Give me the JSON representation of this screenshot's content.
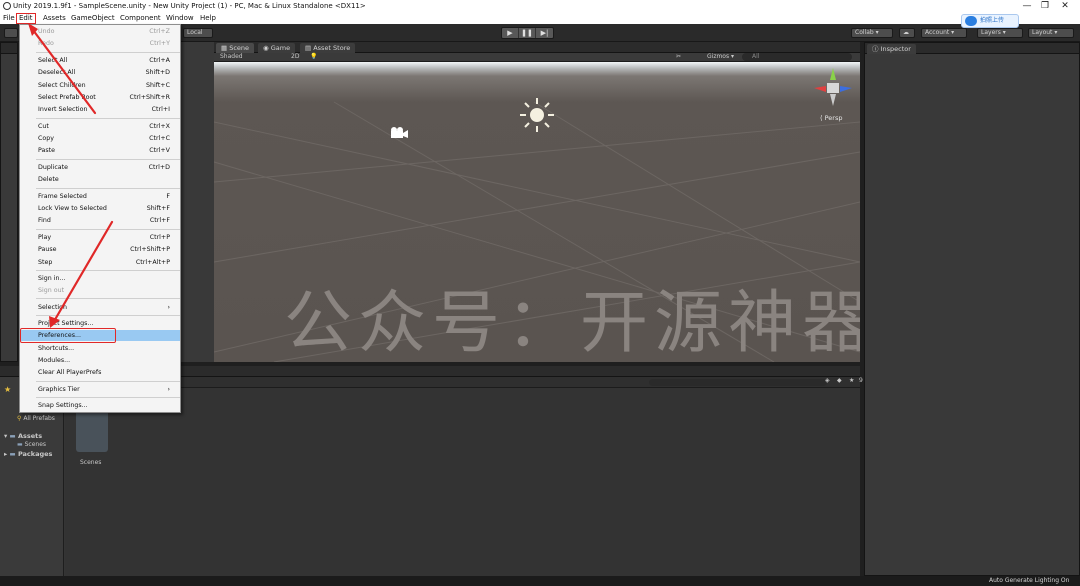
{
  "window": {
    "title": "Unity 2019.1.9f1 - SampleScene.unity - New Unity Project (1) - PC, Mac & Linux Standalone <DX11>",
    "controls": [
      "—",
      "❐",
      "✕"
    ]
  },
  "menubar": {
    "items": [
      "File",
      "Edit",
      "Assets",
      "GameObject",
      "Component",
      "Window",
      "Help"
    ]
  },
  "toolbar": {
    "local_label": "Local",
    "collab_label": "Collab",
    "account_label": "Account",
    "layers_label": "Layers",
    "layout_label": "Layout",
    "upload_badge": "拍照上传"
  },
  "edit_menu": {
    "groups": [
      [
        {
          "label": "Undo",
          "shortcut": "Ctrl+Z",
          "disabled": true
        },
        {
          "label": "Redo",
          "shortcut": "Ctrl+Y",
          "disabled": true
        }
      ],
      [
        {
          "label": "Select All",
          "shortcut": "Ctrl+A"
        },
        {
          "label": "Deselect All",
          "shortcut": "Shift+D"
        },
        {
          "label": "Select Children",
          "shortcut": "Shift+C"
        },
        {
          "label": "Select Prefab Root",
          "shortcut": "Ctrl+Shift+R"
        },
        {
          "label": "Invert Selection",
          "shortcut": "Ctrl+I"
        }
      ],
      [
        {
          "label": "Cut",
          "shortcut": "Ctrl+X"
        },
        {
          "label": "Copy",
          "shortcut": "Ctrl+C"
        },
        {
          "label": "Paste",
          "shortcut": "Ctrl+V"
        }
      ],
      [
        {
          "label": "Duplicate",
          "shortcut": "Ctrl+D"
        },
        {
          "label": "Delete",
          "shortcut": ""
        }
      ],
      [
        {
          "label": "Frame Selected",
          "shortcut": "F"
        },
        {
          "label": "Lock View to Selected",
          "shortcut": "Shift+F"
        },
        {
          "label": "Find",
          "shortcut": "Ctrl+F"
        }
      ],
      [
        {
          "label": "Play",
          "shortcut": "Ctrl+P"
        },
        {
          "label": "Pause",
          "shortcut": "Ctrl+Shift+P"
        },
        {
          "label": "Step",
          "shortcut": "Ctrl+Alt+P"
        }
      ],
      [
        {
          "label": "Sign in...",
          "shortcut": ""
        },
        {
          "label": "Sign out",
          "shortcut": "",
          "disabled": true
        }
      ],
      [
        {
          "label": "Selection",
          "shortcut": "›"
        }
      ],
      [
        {
          "label": "Project Settings...",
          "shortcut": ""
        },
        {
          "label": "Preferences...",
          "shortcut": "",
          "highlighted": true
        },
        {
          "label": "Shortcuts...",
          "shortcut": ""
        },
        {
          "label": "Modules...",
          "shortcut": ""
        },
        {
          "label": "Clear All PlayerPrefs",
          "shortcut": ""
        }
      ],
      [
        {
          "label": "Graphics Tier",
          "shortcut": "›"
        }
      ],
      [
        {
          "label": "Snap Settings...",
          "shortcut": ""
        }
      ]
    ]
  },
  "scene_panel": {
    "tabs": [
      "Scene",
      "Game",
      "Asset Store"
    ],
    "shading_mode": "Shaded",
    "mode_2d": "2D",
    "gizmos_label": "Gizmos",
    "search_placeholder": "All",
    "persp_label": "Persp",
    "watermark": "公众号：开源神器"
  },
  "inspector": {
    "tab": "Inspector"
  },
  "project": {
    "favorites": [
      "All Prefabs"
    ],
    "tree": [
      {
        "label": "Assets",
        "children": [
          "Scenes"
        ]
      },
      {
        "label": "Packages",
        "children": []
      }
    ],
    "folder_items": [
      "Scenes"
    ],
    "count_badge": "9"
  },
  "status": {
    "text": "Auto Generate Lighting On"
  },
  "colors": {
    "highlight_red": "#e02828",
    "menu_selected": "#99c9f2"
  }
}
